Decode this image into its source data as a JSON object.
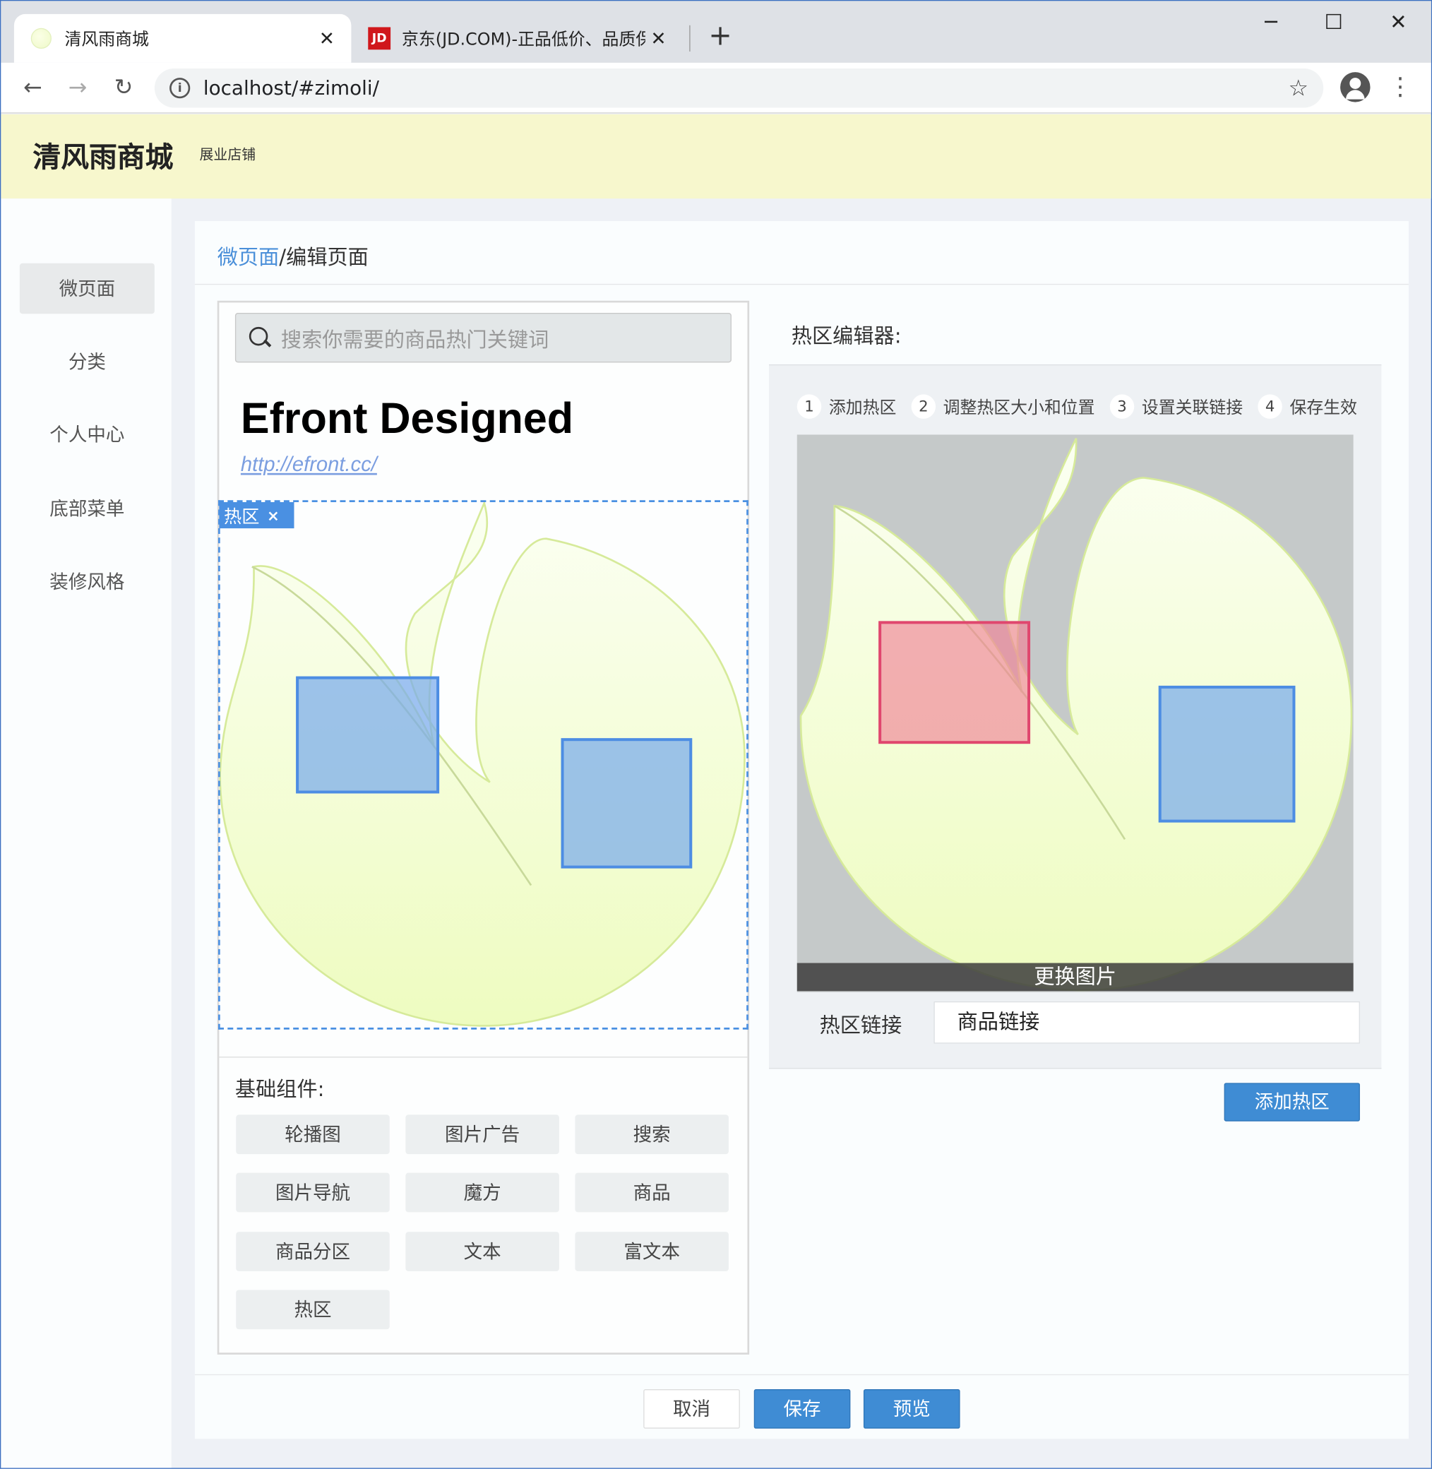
{
  "browser": {
    "tabs": [
      {
        "title": "清风雨商城",
        "active": true
      },
      {
        "title": "京东(JD.COM)-正品低价、品质保障",
        "active": false,
        "favicon_text": "JD"
      }
    ],
    "url": "localhost/#zimoli/"
  },
  "header": {
    "brand": "清风雨商城",
    "sub": "展业店铺"
  },
  "sidebar": {
    "items": [
      {
        "label": "微页面",
        "active": true
      },
      {
        "label": "分类"
      },
      {
        "label": "个人中心"
      },
      {
        "label": "底部菜单"
      },
      {
        "label": "装修风格"
      }
    ]
  },
  "breadcrumb": {
    "link": "微页面",
    "sep": "/",
    "current": "编辑页面"
  },
  "preview": {
    "search_placeholder": "搜索你需要的商品热门关键词",
    "title": "Efront Designed",
    "link": "http://efront.cc/",
    "hot_tag": "热区",
    "hot_tag_close": "×"
  },
  "components": {
    "title": "基础组件:",
    "items": [
      "轮播图",
      "图片广告",
      "搜索",
      "图片导航",
      "魔方",
      "商品",
      "商品分区",
      "文本",
      "富文本",
      "热区"
    ]
  },
  "editor": {
    "title": "热区编辑器:",
    "steps": [
      {
        "num": "1",
        "label": "添加热区"
      },
      {
        "num": "2",
        "label": "调整热区大小和位置"
      },
      {
        "num": "3",
        "label": "设置关联链接"
      },
      {
        "num": "4",
        "label": "保存生效"
      }
    ],
    "change_image": "更换图片",
    "link_label": "热区链接",
    "link_value": "商品链接",
    "add_button": "添加热区"
  },
  "footer": {
    "cancel": "取消",
    "save": "保存",
    "preview": "预览"
  },
  "colors": {
    "accent": "#3f8cd4",
    "header_bg": "#f7f7cd",
    "hotspot_blue": "#4d8de3",
    "hotspot_red": "#e0476e"
  }
}
